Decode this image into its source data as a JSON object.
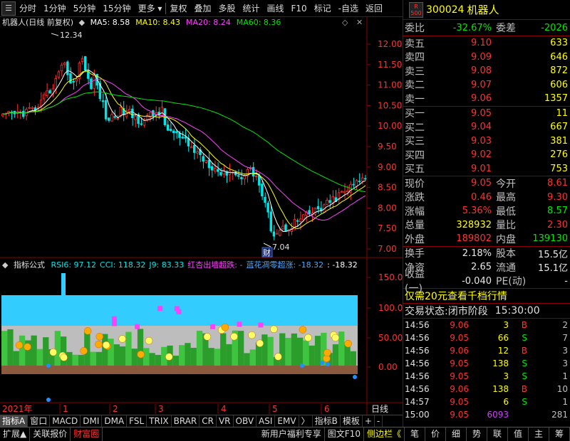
{
  "toolbar": {
    "left": [
      "分时",
      "1分钟",
      "5分钟",
      "15分钟",
      "更多"
    ],
    "right": [
      "复权",
      "叠加",
      "多股",
      "统计",
      "画线",
      "F10",
      "标记",
      "-自选",
      "返回"
    ]
  },
  "chart_header": {
    "title": "机器人(日线 前复权)",
    "ma": [
      {
        "label": "MA5: 8.58",
        "color": "#ffffff"
      },
      {
        "label": "MA10: 8.43",
        "color": "#ffff00"
      },
      {
        "label": "MA20: 8.24",
        "color": "#ff40ff"
      },
      {
        "label": "MA60: 8.36",
        "color": "#00e600"
      }
    ]
  },
  "indicator_header": {
    "title": "指标公式",
    "items": [
      {
        "label": "RSI6: 97.12",
        "color": "#00e6e6"
      },
      {
        "label": "CCI: 118.32",
        "color": "#00e6e6"
      },
      {
        "label": "J9: 83.33",
        "color": "#00e6e6"
      },
      {
        "label": "红杏出墙超跌: -",
        "color": "#ff40ff"
      },
      {
        "label": "蓝花凋零超涨: -18.32",
        "color": "#4aa8ff"
      },
      {
        "label": ": -18.32",
        "color": "#ffffff"
      }
    ]
  },
  "price_axis": [
    "12.00",
    "11.50",
    "11.00",
    "10.50",
    "10.00",
    "9.50",
    "9.00",
    "8.50",
    "8.00",
    "7.50",
    "7.00"
  ],
  "ind_axis": [
    "150.00",
    "100.00",
    "50.00",
    "0.00"
  ],
  "annotations": {
    "high": "12.34",
    "low": "7.04",
    "cai": "财"
  },
  "time_axis": {
    "year": "2021年",
    "months": [
      "1",
      "2",
      "3",
      "4",
      "5",
      "6"
    ],
    "period": "日线"
  },
  "tabs": [
    "指标A",
    "窗口",
    "MACD",
    "DMI",
    "DMA",
    "FSL",
    "TRIX",
    "BRAR",
    "CR",
    "VR",
    "OBV",
    "ASI",
    "EMV",
    "〉",
    "指标B",
    "模板",
    "+",
    "-"
  ],
  "quote": {
    "code": "300024",
    "name": "机器人",
    "market_badge": "R 500",
    "weibi_label": "委比",
    "weibi": "-32.67%",
    "weicha_label": "委差",
    "weicha": "-2026",
    "asks": [
      {
        "label": "卖五",
        "price": "9.10",
        "vol": "633"
      },
      {
        "label": "卖四",
        "price": "9.09",
        "vol": "646"
      },
      {
        "label": "卖三",
        "price": "9.08",
        "vol": "872"
      },
      {
        "label": "卖二",
        "price": "9.07",
        "vol": "606"
      },
      {
        "label": "卖一",
        "price": "9.06",
        "vol": "1357"
      }
    ],
    "bids": [
      {
        "label": "买一",
        "price": "9.05",
        "vol": "11"
      },
      {
        "label": "买二",
        "price": "9.04",
        "vol": "667"
      },
      {
        "label": "买三",
        "price": "9.03",
        "vol": "381"
      },
      {
        "label": "买四",
        "price": "9.02",
        "vol": "276"
      },
      {
        "label": "买五",
        "price": "9.01",
        "vol": "753"
      }
    ],
    "stats": [
      {
        "l1": "现价",
        "v1": "9.05",
        "c1": "red",
        "l2": "今开",
        "v2": "8.61",
        "c2": "red"
      },
      {
        "l1": "涨跌",
        "v1": "0.46",
        "c1": "red",
        "l2": "最高",
        "v2": "9.30",
        "c2": "red"
      },
      {
        "l1": "涨幅",
        "v1": "5.36%",
        "c1": "red",
        "l2": "最低",
        "v2": "8.57",
        "c2": "green"
      },
      {
        "l1": "总量",
        "v1": "328932",
        "c1": "yellow",
        "l2": "量比",
        "v2": "2.30",
        "c2": "red"
      },
      {
        "l1": "外盘",
        "v1": "189802",
        "c1": "red",
        "l2": "内盘",
        "v2": "139130",
        "c2": "green"
      }
    ],
    "stats2": [
      {
        "l1": "换手",
        "v1": "2.18%",
        "c1": "white",
        "l2": "股本",
        "v2": "15.5亿",
        "c2": "white"
      },
      {
        "l1": "净资",
        "v1": "2.65",
        "c1": "white",
        "l2": "流通",
        "v2": "15.1亿",
        "c2": "white"
      },
      {
        "l1": "收益(一)",
        "v1": "-0.040",
        "c1": "white",
        "l2": "PE(动)",
        "v2": "-",
        "c2": "white"
      }
    ],
    "promo": "仅需20元查看千档行情",
    "trade_status_label": "交易状态:",
    "trade_status": "闭市阶段",
    "trade_time": "15:30:00",
    "ticks": [
      {
        "t": "14:56",
        "p": "9.06",
        "q": "3",
        "bs": "B",
        "n": "2",
        "qc": "yellow"
      },
      {
        "t": "14:56",
        "p": "9.05",
        "q": "66",
        "bs": "S",
        "n": "7",
        "qc": "yellow"
      },
      {
        "t": "14:56",
        "p": "9.06",
        "q": "12",
        "bs": "B",
        "n": "3",
        "qc": "yellow"
      },
      {
        "t": "14:56",
        "p": "9.05",
        "q": "138",
        "bs": "S",
        "n": "3",
        "qc": "yellow"
      },
      {
        "t": "14:56",
        "p": "9.05",
        "q": "3",
        "bs": "S",
        "n": "1",
        "qc": "yellow"
      },
      {
        "t": "14:56",
        "p": "9.06",
        "q": "138",
        "bs": "B",
        "n": "10",
        "qc": "yellow"
      },
      {
        "t": "14:57",
        "p": "9.05",
        "q": "6",
        "bs": "S",
        "n": "1",
        "qc": "yellow"
      },
      {
        "t": "15:00",
        "p": "9.05",
        "q": "6093",
        "bs": "",
        "n": "281",
        "qc": "purple"
      }
    ],
    "rtabs": [
      "笔",
      "价",
      "细",
      "势",
      "联",
      "值",
      "主",
      "筹"
    ]
  },
  "bottom": {
    "left": [
      "扩展",
      "关联报价",
      "财富圈"
    ],
    "right": [
      "新用户福利专享",
      "图文F10",
      "侧边栏"
    ]
  },
  "colors": {
    "up": "#ff3232",
    "down": "#00e6e6",
    "ma5": "#ffffff",
    "ma10": "#ffff00",
    "ma20": "#ff40ff",
    "ma60": "#00e600"
  }
}
